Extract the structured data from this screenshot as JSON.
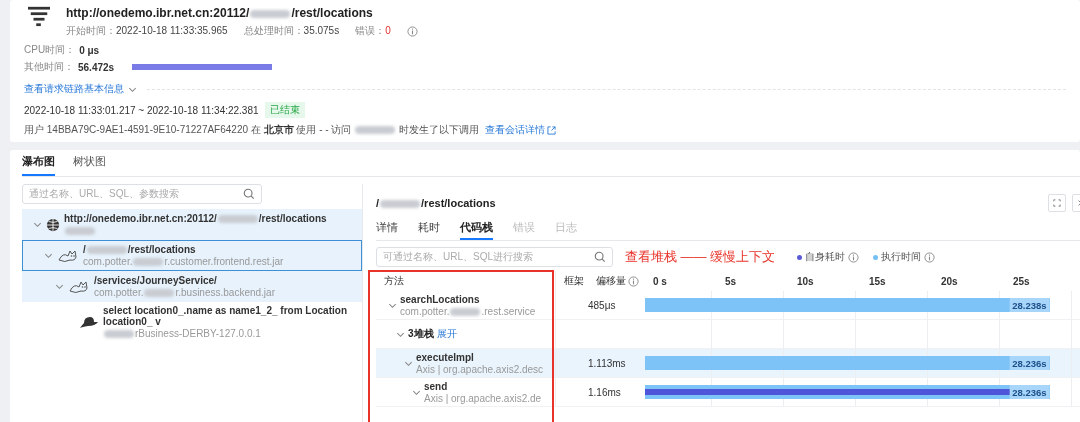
{
  "header": {
    "title_parts": [
      {
        "kind": "text",
        "text": "http://onedemo.ibr.net.cn:20112/"
      },
      {
        "kind": "redacted"
      },
      {
        "kind": "text",
        "text": "/rest/locations"
      }
    ],
    "meta": [
      {
        "label": "开始时间：",
        "value": "2022-10-18 11:33:35.965"
      },
      {
        "label": "总处理时间：",
        "value": "35.075s"
      },
      {
        "label": "错误：",
        "value": "0",
        "kind": "error"
      }
    ],
    "metrics": [
      {
        "label": "CPU时间：",
        "value": "0 μs",
        "kind": "plain"
      },
      {
        "label": "其他时间：",
        "value": "56.472s",
        "kind": "bar"
      }
    ],
    "info_link": "查看请求链路基本信息",
    "time_range": "2022-10-18 11:33:01.217 ~ 2022-10-18 11:34:22.381",
    "status": "已结束",
    "user_line": {
      "parts": [
        "用户 14BBA79C-9AE1-4591-9E10-71227AF64220 在 ",
        "北京市",
        " 使用 - - 访问 ",
        " 时发生了以下调用"
      ],
      "link": "查看会话详情"
    }
  },
  "view_tabs": [
    {
      "label": "瀑布图",
      "selected": true
    },
    {
      "label": "树状图",
      "selected": false
    }
  ],
  "tree_search": {
    "placeholder": "通过名称、URL、SQL、参数搜索"
  },
  "tree": [
    {
      "kind": "http",
      "title_parts": [
        {
          "kind": "text",
          "text": "http://onedemo.ibr.net.cn:20112/"
        },
        {
          "kind": "redacted"
        },
        {
          "kind": "text",
          "text": "/rest/locations"
        }
      ],
      "sub_parts": [
        {
          "kind": "redacted"
        }
      ],
      "selected": false,
      "highlighted": true,
      "children": [
        {
          "kind": "tomcat",
          "title_parts": [
            {
              "kind": "text",
              "text": "/"
            },
            {
              "kind": "redacted"
            },
            {
              "kind": "text",
              "text": "/rest/locations"
            }
          ],
          "sub_parts": [
            {
              "kind": "text",
              "text": "com.potter."
            },
            {
              "kind": "redacted"
            },
            {
              "kind": "text",
              "text": "r.customer.frontend.rest.jar"
            }
          ],
          "selected": true,
          "highlighted": true,
          "children": [
            {
              "kind": "tomcat",
              "title_parts": [
                {
                  "kind": "text",
                  "text": "/services/JourneyService/"
                }
              ],
              "sub_parts": [
                {
                  "kind": "text",
                  "text": "com.potter."
                },
                {
                  "kind": "redacted"
                },
                {
                  "kind": "text",
                  "text": "r.business.backend.jar"
                }
              ],
              "selected": false,
              "highlighted": true,
              "children": [
                {
                  "kind": "db",
                  "title_parts": [
                    {
                      "kind": "text",
                      "text": "select location0_.name as name1_2_ from Location location0_ v"
                    }
                  ],
                  "sub_parts": [
                    {
                      "kind": "redacted"
                    },
                    {
                      "kind": "text",
                      "text": "rBusiness-DERBY-127.0.0.1"
                    }
                  ],
                  "selected": false,
                  "highlighted": false
                }
              ]
            }
          ]
        }
      ]
    }
  ],
  "detail": {
    "title_parts": [
      {
        "kind": "text",
        "text": "/"
      },
      {
        "kind": "redacted"
      },
      {
        "kind": "text",
        "text": "/rest/locations"
      }
    ],
    "tabs": [
      {
        "label": "详情",
        "selected": false,
        "disabled": false
      },
      {
        "label": "耗时",
        "selected": false,
        "disabled": false
      },
      {
        "label": "代码栈",
        "selected": true,
        "disabled": false
      },
      {
        "label": "错误",
        "selected": false,
        "disabled": true
      },
      {
        "label": "日志",
        "selected": false,
        "disabled": true
      }
    ],
    "search": {
      "placeholder": "可通过名称、URL、SQL进行搜索"
    },
    "annotation": "查看堆栈 —— 缓慢上下文",
    "legend": [
      {
        "label": "自身耗时",
        "color": "#5b5bd6"
      },
      {
        "label": "执行时间",
        "color": "#74c0f5"
      }
    ],
    "columns": [
      "方法",
      "框架",
      "偏移量"
    ],
    "ticks": [
      "0 s",
      "5s",
      "10s",
      "15s",
      "20s",
      "25s"
    ],
    "rows": [
      {
        "kind": "method",
        "name": "searchLocations",
        "sub_parts": [
          {
            "kind": "text",
            "text": "com.potter."
          },
          {
            "kind": "redacted"
          },
          {
            "kind": "text",
            "text": ".rest.service"
          }
        ],
        "offset": "485μs",
        "bars": [
          {
            "kind": "exec",
            "level": 0.93
          }
        ],
        "duration": "28.238s",
        "highlighted": false,
        "children": [
          {
            "kind": "group",
            "name": "3堆栈",
            "link": "展开",
            "children": [
              {
                "kind": "method",
                "name": "executeImpl",
                "sub_parts": [
                  {
                    "kind": "text",
                    "text": "Axis | org.apache.axis2.desc"
                  }
                ],
                "offset": "1.113ms",
                "bars": [
                  {
                    "kind": "exec",
                    "level": 0.93
                  }
                ],
                "duration": "28.236s",
                "highlighted": true,
                "children": [
                  {
                    "kind": "method",
                    "name": "send",
                    "sub_parts": [
                      {
                        "kind": "text",
                        "text": "Axis | org.apache.axis2.de"
                      }
                    ],
                    "offset": "1.16ms",
                    "bars": [
                      {
                        "kind": "exec",
                        "level": 0.93
                      },
                      {
                        "kind": "self",
                        "level": 0.925
                      }
                    ],
                    "duration": "28.236s",
                    "highlighted": false
                  }
                ]
              }
            ]
          }
        ]
      }
    ]
  }
}
